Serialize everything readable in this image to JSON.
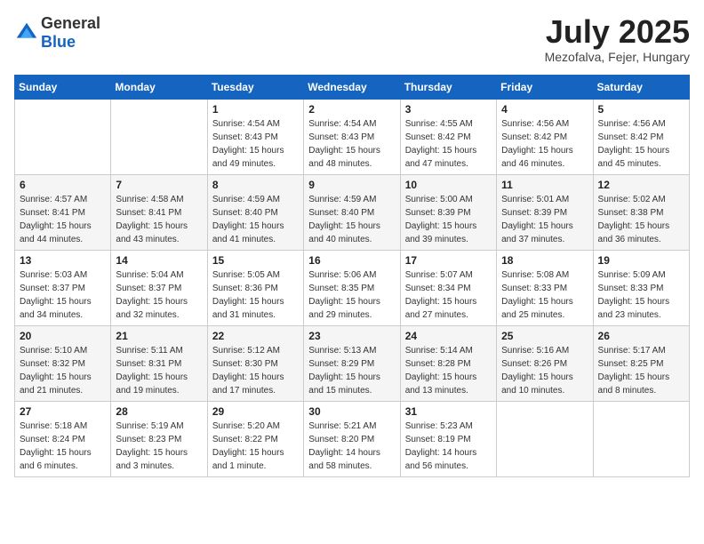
{
  "header": {
    "logo_general": "General",
    "logo_blue": "Blue",
    "month": "July 2025",
    "location": "Mezofalva, Fejer, Hungary"
  },
  "weekdays": [
    "Sunday",
    "Monday",
    "Tuesday",
    "Wednesday",
    "Thursday",
    "Friday",
    "Saturday"
  ],
  "weeks": [
    [
      {
        "day": "",
        "sunrise": "",
        "sunset": "",
        "daylight": ""
      },
      {
        "day": "",
        "sunrise": "",
        "sunset": "",
        "daylight": ""
      },
      {
        "day": "1",
        "sunrise": "Sunrise: 4:54 AM",
        "sunset": "Sunset: 8:43 PM",
        "daylight": "Daylight: 15 hours and 49 minutes."
      },
      {
        "day": "2",
        "sunrise": "Sunrise: 4:54 AM",
        "sunset": "Sunset: 8:43 PM",
        "daylight": "Daylight: 15 hours and 48 minutes."
      },
      {
        "day": "3",
        "sunrise": "Sunrise: 4:55 AM",
        "sunset": "Sunset: 8:42 PM",
        "daylight": "Daylight: 15 hours and 47 minutes."
      },
      {
        "day": "4",
        "sunrise": "Sunrise: 4:56 AM",
        "sunset": "Sunset: 8:42 PM",
        "daylight": "Daylight: 15 hours and 46 minutes."
      },
      {
        "day": "5",
        "sunrise": "Sunrise: 4:56 AM",
        "sunset": "Sunset: 8:42 PM",
        "daylight": "Daylight: 15 hours and 45 minutes."
      }
    ],
    [
      {
        "day": "6",
        "sunrise": "Sunrise: 4:57 AM",
        "sunset": "Sunset: 8:41 PM",
        "daylight": "Daylight: 15 hours and 44 minutes."
      },
      {
        "day": "7",
        "sunrise": "Sunrise: 4:58 AM",
        "sunset": "Sunset: 8:41 PM",
        "daylight": "Daylight: 15 hours and 43 minutes."
      },
      {
        "day": "8",
        "sunrise": "Sunrise: 4:59 AM",
        "sunset": "Sunset: 8:40 PM",
        "daylight": "Daylight: 15 hours and 41 minutes."
      },
      {
        "day": "9",
        "sunrise": "Sunrise: 4:59 AM",
        "sunset": "Sunset: 8:40 PM",
        "daylight": "Daylight: 15 hours and 40 minutes."
      },
      {
        "day": "10",
        "sunrise": "Sunrise: 5:00 AM",
        "sunset": "Sunset: 8:39 PM",
        "daylight": "Daylight: 15 hours and 39 minutes."
      },
      {
        "day": "11",
        "sunrise": "Sunrise: 5:01 AM",
        "sunset": "Sunset: 8:39 PM",
        "daylight": "Daylight: 15 hours and 37 minutes."
      },
      {
        "day": "12",
        "sunrise": "Sunrise: 5:02 AM",
        "sunset": "Sunset: 8:38 PM",
        "daylight": "Daylight: 15 hours and 36 minutes."
      }
    ],
    [
      {
        "day": "13",
        "sunrise": "Sunrise: 5:03 AM",
        "sunset": "Sunset: 8:37 PM",
        "daylight": "Daylight: 15 hours and 34 minutes."
      },
      {
        "day": "14",
        "sunrise": "Sunrise: 5:04 AM",
        "sunset": "Sunset: 8:37 PM",
        "daylight": "Daylight: 15 hours and 32 minutes."
      },
      {
        "day": "15",
        "sunrise": "Sunrise: 5:05 AM",
        "sunset": "Sunset: 8:36 PM",
        "daylight": "Daylight: 15 hours and 31 minutes."
      },
      {
        "day": "16",
        "sunrise": "Sunrise: 5:06 AM",
        "sunset": "Sunset: 8:35 PM",
        "daylight": "Daylight: 15 hours and 29 minutes."
      },
      {
        "day": "17",
        "sunrise": "Sunrise: 5:07 AM",
        "sunset": "Sunset: 8:34 PM",
        "daylight": "Daylight: 15 hours and 27 minutes."
      },
      {
        "day": "18",
        "sunrise": "Sunrise: 5:08 AM",
        "sunset": "Sunset: 8:33 PM",
        "daylight": "Daylight: 15 hours and 25 minutes."
      },
      {
        "day": "19",
        "sunrise": "Sunrise: 5:09 AM",
        "sunset": "Sunset: 8:33 PM",
        "daylight": "Daylight: 15 hours and 23 minutes."
      }
    ],
    [
      {
        "day": "20",
        "sunrise": "Sunrise: 5:10 AM",
        "sunset": "Sunset: 8:32 PM",
        "daylight": "Daylight: 15 hours and 21 minutes."
      },
      {
        "day": "21",
        "sunrise": "Sunrise: 5:11 AM",
        "sunset": "Sunset: 8:31 PM",
        "daylight": "Daylight: 15 hours and 19 minutes."
      },
      {
        "day": "22",
        "sunrise": "Sunrise: 5:12 AM",
        "sunset": "Sunset: 8:30 PM",
        "daylight": "Daylight: 15 hours and 17 minutes."
      },
      {
        "day": "23",
        "sunrise": "Sunrise: 5:13 AM",
        "sunset": "Sunset: 8:29 PM",
        "daylight": "Daylight: 15 hours and 15 minutes."
      },
      {
        "day": "24",
        "sunrise": "Sunrise: 5:14 AM",
        "sunset": "Sunset: 8:28 PM",
        "daylight": "Daylight: 15 hours and 13 minutes."
      },
      {
        "day": "25",
        "sunrise": "Sunrise: 5:16 AM",
        "sunset": "Sunset: 8:26 PM",
        "daylight": "Daylight: 15 hours and 10 minutes."
      },
      {
        "day": "26",
        "sunrise": "Sunrise: 5:17 AM",
        "sunset": "Sunset: 8:25 PM",
        "daylight": "Daylight: 15 hours and 8 minutes."
      }
    ],
    [
      {
        "day": "27",
        "sunrise": "Sunrise: 5:18 AM",
        "sunset": "Sunset: 8:24 PM",
        "daylight": "Daylight: 15 hours and 6 minutes."
      },
      {
        "day": "28",
        "sunrise": "Sunrise: 5:19 AM",
        "sunset": "Sunset: 8:23 PM",
        "daylight": "Daylight: 15 hours and 3 minutes."
      },
      {
        "day": "29",
        "sunrise": "Sunrise: 5:20 AM",
        "sunset": "Sunset: 8:22 PM",
        "daylight": "Daylight: 15 hours and 1 minute."
      },
      {
        "day": "30",
        "sunrise": "Sunrise: 5:21 AM",
        "sunset": "Sunset: 8:20 PM",
        "daylight": "Daylight: 14 hours and 58 minutes."
      },
      {
        "day": "31",
        "sunrise": "Sunrise: 5:23 AM",
        "sunset": "Sunset: 8:19 PM",
        "daylight": "Daylight: 14 hours and 56 minutes."
      },
      {
        "day": "",
        "sunrise": "",
        "sunset": "",
        "daylight": ""
      },
      {
        "day": "",
        "sunrise": "",
        "sunset": "",
        "daylight": ""
      }
    ]
  ]
}
